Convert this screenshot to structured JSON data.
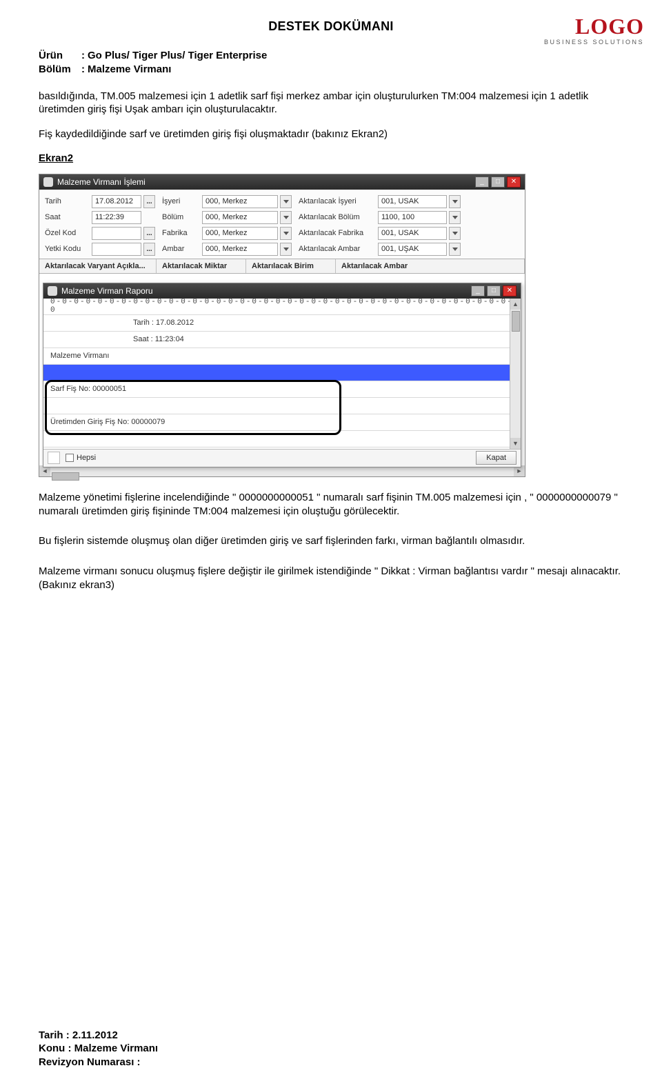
{
  "doc": {
    "title": "DESTEK DOKÜMANI",
    "meta": {
      "urun_label": "Ürün",
      "urun_value": "Go Plus/ Tiger Plus/ Tiger Enterprise",
      "bolum_label": "Bölüm",
      "bolum_value": "Malzeme Virmanı"
    },
    "logo": {
      "brand": "LOGO",
      "sub": "BUSINESS SOLUTIONS"
    },
    "p1": "basıldığında, TM.005 malzemesi için 1 adetlik sarf fişi merkez ambar için oluşturulurken TM:004 malzemesi için 1 adetlik üretimden giriş fişi Uşak ambarı için oluşturulacaktır.",
    "p2": "Fiş kaydedildiğinde sarf ve üretimden giriş fişi oluşmaktadır (bakınız Ekran2)",
    "ekran_label": "Ekran2",
    "p3": "Malzeme yönetimi fişlerine incelendiğinde \" 0000000000051 \" numaralı sarf fişinin TM.005 malzemesi için , \" 0000000000079 \" numaralı üretimden giriş fişininde TM:004 malzemesi için oluştuğu görülecektir.",
    "p4": "Bu fişlerin sistemde oluşmuş olan diğer üretimden giriş ve sarf fişlerinden farkı, virman bağlantılı olmasıdır.",
    "p5": "Malzeme virmanı sonucu oluşmuş fişlere değiştir ile girilmek istendiğinde \" Dikkat : Virman bağlantısı vardır \" mesajı alınacaktır. (Bakınız ekran3)",
    "footer": {
      "tarih": "Tarih : 2.11.2012",
      "konu": "Konu : Malzeme Virmanı",
      "rev": "Revizyon Numarası :"
    }
  },
  "win1": {
    "title": "Malzeme Virmanı İşlemi",
    "labels": {
      "tarih": "Tarih",
      "saat": "Saat",
      "ozelkod": "Özel Kod",
      "yetki": "Yetki Kodu",
      "isyeri": "İşyeri",
      "bolum": "Bölüm",
      "fabrika": "Fabrika",
      "ambar": "Ambar",
      "akt_isyeri": "Aktarılacak İşyeri",
      "akt_bolum": "Aktarılacak Bölüm",
      "akt_fabrika": "Aktarılacak Fabrika",
      "akt_ambar": "Aktarılacak Ambar"
    },
    "vals": {
      "tarih": "17.08.2012",
      "saat": "11:22:39",
      "ozelkod": "",
      "yetki": "",
      "isyeri": "000, Merkez",
      "bolum": "000, Merkez",
      "fabrika": "000, Merkez",
      "ambar": "000, Merkez",
      "akt_isyeri": "001, USAK",
      "akt_bolum": "1100, 100",
      "akt_fabrika": "001, USAK",
      "akt_ambar": "001, UŞAK"
    },
    "grid": {
      "c1": "Aktarılacak Varyant Açıkla...",
      "c2": "Aktarılacak Miktar",
      "c3": "Aktarılacak Birim",
      "c4": "Aktarılacak Ambar"
    }
  },
  "win2": {
    "title": "Malzeme Virman Raporu",
    "rows": {
      "r1": "0-0-0-0-0-0-0-0-0-0-0-0-0-0-0-0-0-0-0-0-0-0-0-0-0-0-0-0-0-0-0-0-0-0-0-0-0-0-0-0",
      "r2": "Tarih : 17.08.2012",
      "r3": "Saat : 11:23:04",
      "r4": "Malzeme Virmanı",
      "r5": "Sarf Fiş No: 00000051",
      "r6": "Üretimden Giriş Fiş No: 00000079"
    },
    "hepsi": "Hepsi",
    "kapat": "Kapat"
  }
}
